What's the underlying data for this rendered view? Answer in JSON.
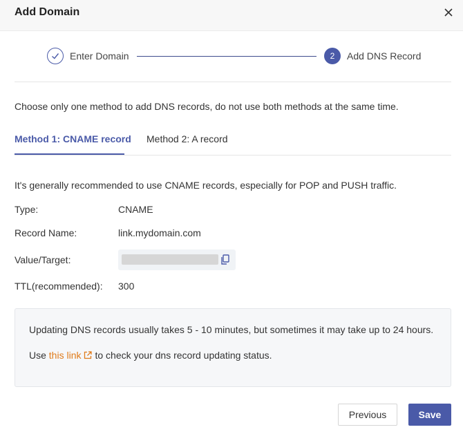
{
  "dialog": {
    "title": "Add Domain"
  },
  "steps": [
    {
      "label": "Enter Domain",
      "status": "done"
    },
    {
      "number": "2",
      "label": "Add DNS Record",
      "status": "active"
    }
  ],
  "instruction": "Choose only one method to add DNS records, do not use both methods at the same time.",
  "tabs": [
    {
      "label": "Method 1: CNAME record",
      "active": true
    },
    {
      "label": "Method 2: A record",
      "active": false
    }
  ],
  "recommendation": "It's generally recommended to use CNAME records, especially for POP and PUSH traffic.",
  "fields": {
    "type": {
      "label": "Type:",
      "value": "CNAME"
    },
    "record_name": {
      "label": "Record Name:",
      "value": "link.mydomain.com"
    },
    "value_target": {
      "label": "Value/Target:",
      "value": ""
    },
    "ttl": {
      "label": "TTL(recommended):",
      "value": "300"
    }
  },
  "info": {
    "line1": "Updating DNS records usually takes 5 - 10 minutes, but sometimes it may take up to 24 hours.",
    "line2_prefix": "Use",
    "link_text": "this link",
    "line2_suffix": "to check your dns record updating status."
  },
  "buttons": {
    "previous": "Previous",
    "save": "Save"
  },
  "colors": {
    "accent": "#4a5aa8",
    "link": "#e07b1a"
  },
  "icons": {
    "close": "close-icon",
    "step_done": "check-icon",
    "copy": "copy-icon",
    "external_link": "external-link-icon"
  }
}
